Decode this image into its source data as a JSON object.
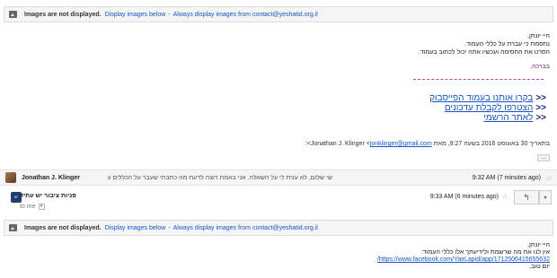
{
  "banner": {
    "label": "Images are not displayed.",
    "display_link": "Display images below",
    "separator": "-",
    "always_link": "Always display images from contact@yeshatid.org.il"
  },
  "message1": {
    "greeting": "היי יונתן,",
    "line1": "נחסמת כי עברת על כללי העמוד.",
    "line2": "הסרנו את החסימה ועכשיו אתה יכול לכתוב בעמוד.",
    "signoff": "בברכה,",
    "links": [
      {
        "arrow": "<<",
        "text": "בקרו אותנו בעמוד הפייסבוק"
      },
      {
        "arrow": "<<",
        "text": "הצטרפו לקבלת עדכונים"
      },
      {
        "arrow": "<<",
        "text": "לאתר הרשמי"
      }
    ],
    "quote_prefix": "בתאריך 30 באוגוסט 2016 בשעה 9:27, מאת Jonathan J. Klinger <",
    "quote_email": "jonklinger@gmail.com",
    "quote_suffix": ">:",
    "more_dots": "..."
  },
  "collapsed": {
    "sender": "Jonathan J. Klinger",
    "snippet": "שי שלום, לא ענית לי על השאלה. אני באמת רוצה לדעת מה כתבתי שעבר על הכללים של ...",
    "time": "9:32 AM (7 minutes ago)"
  },
  "message2": {
    "sender": "פניות ציבור יש עתיד",
    "avatar_text": "יש עתיד",
    "to": "to me",
    "time": "9:33 AM (6 minutes ago)",
    "greeting": "היי יונתן,",
    "line1": "אין לנו את מה שרשמת ולידיעתך אלו כללי העמוד:",
    "url": "https://www.facebook.com/YairLapid/app/1712506415655632/",
    "signoff": "יום טוב,"
  },
  "colors": {
    "link": "#1155cc",
    "purple": "#7a1f7a"
  },
  "icons": [
    "image-icon",
    "star-icon",
    "reply-icon",
    "more-icon",
    "chevron-down-icon"
  ]
}
